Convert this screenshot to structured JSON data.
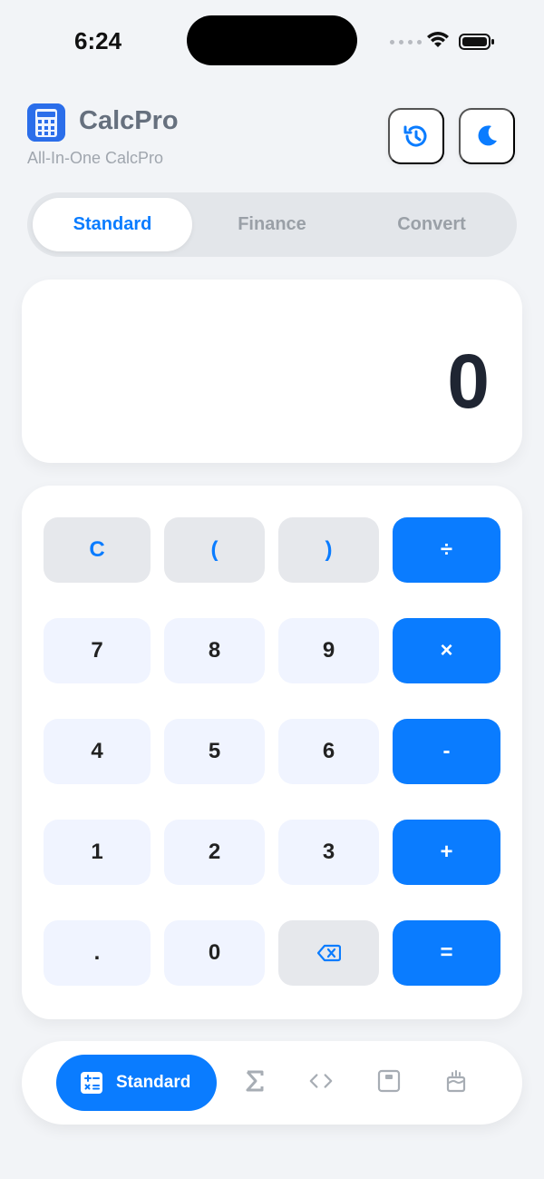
{
  "status": {
    "time": "6:24"
  },
  "header": {
    "title": "CalcPro",
    "subtitle": "All-In-One CalcPro"
  },
  "tabs": [
    "Standard",
    "Finance",
    "Convert"
  ],
  "display": {
    "value": "0"
  },
  "keys": {
    "row1": [
      "C",
      "(",
      ")",
      "÷"
    ],
    "row2": [
      "7",
      "8",
      "9",
      "×"
    ],
    "row3": [
      "4",
      "5",
      "6",
      "-"
    ],
    "row4": [
      "1",
      "2",
      "3",
      "+"
    ],
    "row5": [
      ".",
      "0",
      "=",
      "backspace-icon"
    ]
  },
  "bottom_nav": {
    "active_label": "Standard",
    "icons": [
      "calculator-icon",
      "sigma-icon",
      "code-icon",
      "calendar-icon",
      "cake-icon"
    ]
  },
  "colors": {
    "accent": "#0A7CFF",
    "background": "#F2F4F7"
  }
}
